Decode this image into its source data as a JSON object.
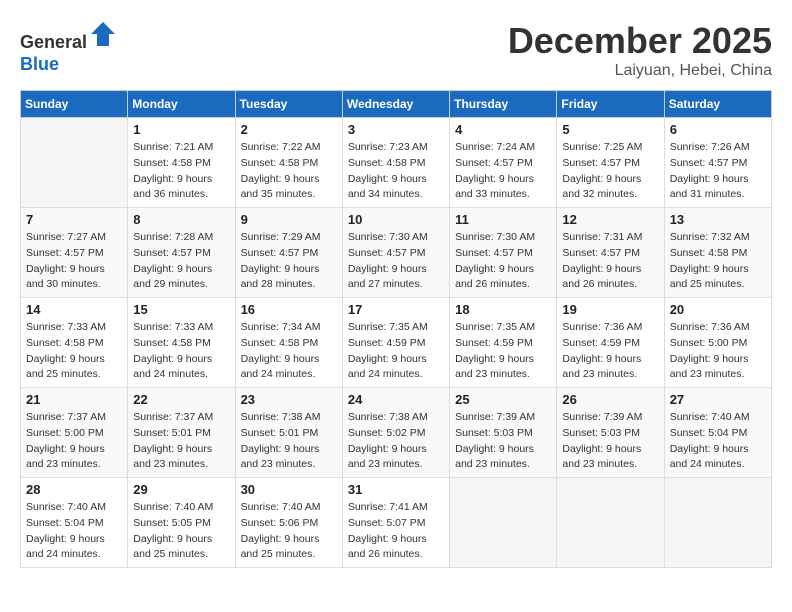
{
  "header": {
    "logo_line1": "General",
    "logo_line2": "Blue",
    "month": "December 2025",
    "location": "Laiyuan, Hebei, China"
  },
  "weekdays": [
    "Sunday",
    "Monday",
    "Tuesday",
    "Wednesday",
    "Thursday",
    "Friday",
    "Saturday"
  ],
  "weeks": [
    [
      {
        "day": "",
        "info": ""
      },
      {
        "day": "1",
        "info": "Sunrise: 7:21 AM\nSunset: 4:58 PM\nDaylight: 9 hours\nand 36 minutes."
      },
      {
        "day": "2",
        "info": "Sunrise: 7:22 AM\nSunset: 4:58 PM\nDaylight: 9 hours\nand 35 minutes."
      },
      {
        "day": "3",
        "info": "Sunrise: 7:23 AM\nSunset: 4:58 PM\nDaylight: 9 hours\nand 34 minutes."
      },
      {
        "day": "4",
        "info": "Sunrise: 7:24 AM\nSunset: 4:57 PM\nDaylight: 9 hours\nand 33 minutes."
      },
      {
        "day": "5",
        "info": "Sunrise: 7:25 AM\nSunset: 4:57 PM\nDaylight: 9 hours\nand 32 minutes."
      },
      {
        "day": "6",
        "info": "Sunrise: 7:26 AM\nSunset: 4:57 PM\nDaylight: 9 hours\nand 31 minutes."
      }
    ],
    [
      {
        "day": "7",
        "info": "Sunrise: 7:27 AM\nSunset: 4:57 PM\nDaylight: 9 hours\nand 30 minutes."
      },
      {
        "day": "8",
        "info": "Sunrise: 7:28 AM\nSunset: 4:57 PM\nDaylight: 9 hours\nand 29 minutes."
      },
      {
        "day": "9",
        "info": "Sunrise: 7:29 AM\nSunset: 4:57 PM\nDaylight: 9 hours\nand 28 minutes."
      },
      {
        "day": "10",
        "info": "Sunrise: 7:30 AM\nSunset: 4:57 PM\nDaylight: 9 hours\nand 27 minutes."
      },
      {
        "day": "11",
        "info": "Sunrise: 7:30 AM\nSunset: 4:57 PM\nDaylight: 9 hours\nand 26 minutes."
      },
      {
        "day": "12",
        "info": "Sunrise: 7:31 AM\nSunset: 4:57 PM\nDaylight: 9 hours\nand 26 minutes."
      },
      {
        "day": "13",
        "info": "Sunrise: 7:32 AM\nSunset: 4:58 PM\nDaylight: 9 hours\nand 25 minutes."
      }
    ],
    [
      {
        "day": "14",
        "info": "Sunrise: 7:33 AM\nSunset: 4:58 PM\nDaylight: 9 hours\nand 25 minutes."
      },
      {
        "day": "15",
        "info": "Sunrise: 7:33 AM\nSunset: 4:58 PM\nDaylight: 9 hours\nand 24 minutes."
      },
      {
        "day": "16",
        "info": "Sunrise: 7:34 AM\nSunset: 4:58 PM\nDaylight: 9 hours\nand 24 minutes."
      },
      {
        "day": "17",
        "info": "Sunrise: 7:35 AM\nSunset: 4:59 PM\nDaylight: 9 hours\nand 24 minutes."
      },
      {
        "day": "18",
        "info": "Sunrise: 7:35 AM\nSunset: 4:59 PM\nDaylight: 9 hours\nand 23 minutes."
      },
      {
        "day": "19",
        "info": "Sunrise: 7:36 AM\nSunset: 4:59 PM\nDaylight: 9 hours\nand 23 minutes."
      },
      {
        "day": "20",
        "info": "Sunrise: 7:36 AM\nSunset: 5:00 PM\nDaylight: 9 hours\nand 23 minutes."
      }
    ],
    [
      {
        "day": "21",
        "info": "Sunrise: 7:37 AM\nSunset: 5:00 PM\nDaylight: 9 hours\nand 23 minutes."
      },
      {
        "day": "22",
        "info": "Sunrise: 7:37 AM\nSunset: 5:01 PM\nDaylight: 9 hours\nand 23 minutes."
      },
      {
        "day": "23",
        "info": "Sunrise: 7:38 AM\nSunset: 5:01 PM\nDaylight: 9 hours\nand 23 minutes."
      },
      {
        "day": "24",
        "info": "Sunrise: 7:38 AM\nSunset: 5:02 PM\nDaylight: 9 hours\nand 23 minutes."
      },
      {
        "day": "25",
        "info": "Sunrise: 7:39 AM\nSunset: 5:03 PM\nDaylight: 9 hours\nand 23 minutes."
      },
      {
        "day": "26",
        "info": "Sunrise: 7:39 AM\nSunset: 5:03 PM\nDaylight: 9 hours\nand 23 minutes."
      },
      {
        "day": "27",
        "info": "Sunrise: 7:40 AM\nSunset: 5:04 PM\nDaylight: 9 hours\nand 24 minutes."
      }
    ],
    [
      {
        "day": "28",
        "info": "Sunrise: 7:40 AM\nSunset: 5:04 PM\nDaylight: 9 hours\nand 24 minutes."
      },
      {
        "day": "29",
        "info": "Sunrise: 7:40 AM\nSunset: 5:05 PM\nDaylight: 9 hours\nand 25 minutes."
      },
      {
        "day": "30",
        "info": "Sunrise: 7:40 AM\nSunset: 5:06 PM\nDaylight: 9 hours\nand 25 minutes."
      },
      {
        "day": "31",
        "info": "Sunrise: 7:41 AM\nSunset: 5:07 PM\nDaylight: 9 hours\nand 26 minutes."
      },
      {
        "day": "",
        "info": ""
      },
      {
        "day": "",
        "info": ""
      },
      {
        "day": "",
        "info": ""
      }
    ]
  ]
}
